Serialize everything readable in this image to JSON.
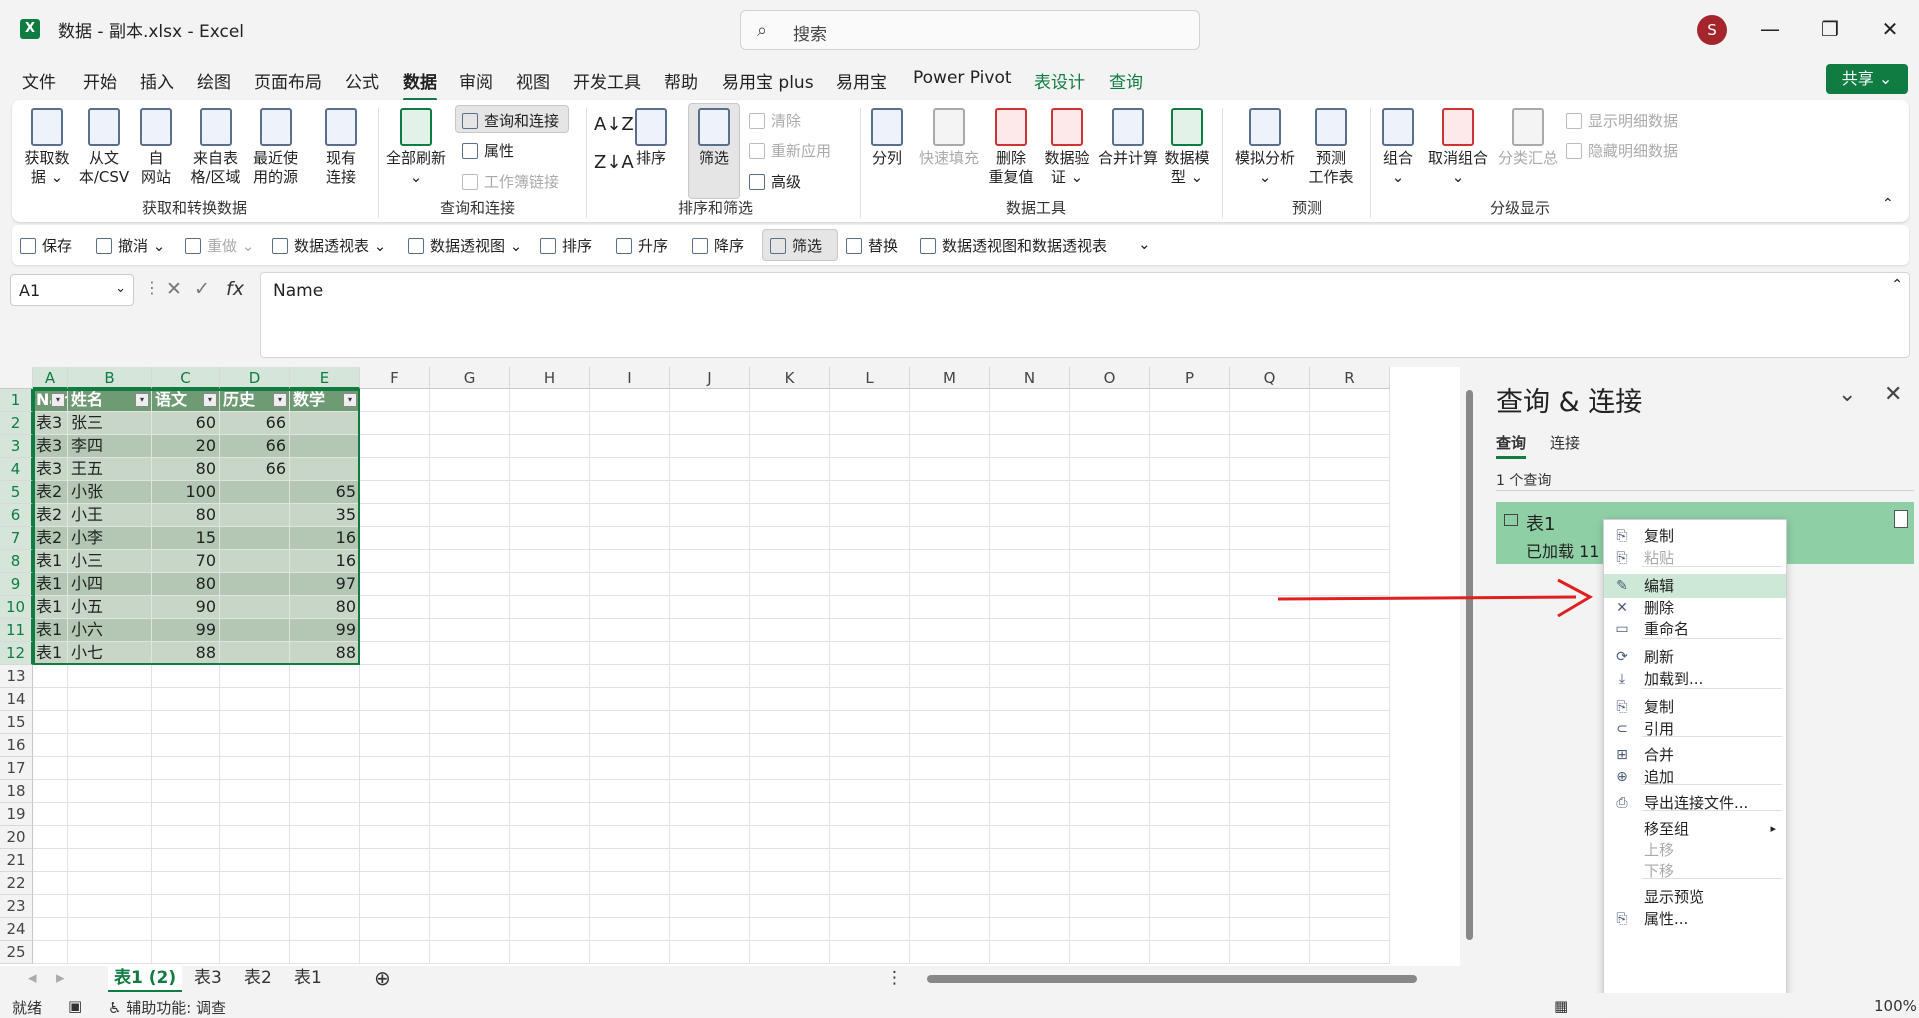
{
  "window": {
    "title": "数据 - 副本.xlsx  -  Excel",
    "search_placeholder": "搜索",
    "avatar": "S",
    "minimize": "—",
    "restore": "❐",
    "close": "✕"
  },
  "menu": {
    "items": [
      "文件",
      "开始",
      "插入",
      "绘图",
      "页面布局",
      "公式",
      "数据",
      "审阅",
      "视图",
      "开发工具",
      "帮助",
      "易用宝 plus",
      "易用宝",
      "Power Pivot",
      "表设计",
      "查询"
    ],
    "active": "数据",
    "share": "共享"
  },
  "ribbon": {
    "get_data": [
      "获取数",
      "据 ⌄"
    ],
    "from_csv": [
      "从文",
      "本/CSV"
    ],
    "from_web": [
      "自",
      "网站"
    ],
    "from_table": [
      "来自表",
      "格/区域"
    ],
    "recent": [
      "最近使",
      "用的源"
    ],
    "existing": [
      "现有",
      "连接"
    ],
    "group1": "获取和转换数据",
    "refresh_all": [
      "全部刷新",
      "⌄"
    ],
    "queries_conn": "查询和连接",
    "properties": "属性",
    "edit_links": "工作簿链接",
    "group2": "查询和连接",
    "sort": "排序",
    "filter": "筛选",
    "clear": "清除",
    "reapply": "重新应用",
    "advanced": "高级",
    "group3": "排序和筛选",
    "text_to_col": "分列",
    "flash_fill": "快速填充",
    "remove_dup": [
      "删除",
      "重复值"
    ],
    "validation": [
      "数据验",
      "证 ⌄"
    ],
    "consolidate": "合并计算",
    "data_model": [
      "数据模",
      "型 ⌄"
    ],
    "group4": "数据工具",
    "whatif": [
      "模拟分析",
      "⌄"
    ],
    "forecast": [
      "预测",
      "工作表"
    ],
    "group5": "预测",
    "group_btn": [
      "组合",
      "⌄"
    ],
    "ungroup": [
      "取消组合",
      "⌄"
    ],
    "subtotal": "分类汇总",
    "show_detail": "显示明细数据",
    "hide_detail": "隐藏明细数据",
    "group6": "分级显示"
  },
  "qat": {
    "save": "保存",
    "undo": "撤消",
    "redo": "重做",
    "pivot_table": "数据透视表",
    "pivot_chart": "数据透视图",
    "sort": "排序",
    "asc": "升序",
    "desc": "降序",
    "filter": "筛选",
    "replace": "替换",
    "pivot_both": "数据透视图和数据透视表"
  },
  "formula_bar": {
    "name_box": "A1",
    "content": "Name",
    "fx": "fx"
  },
  "columns": [
    "A",
    "B",
    "C",
    "D",
    "E",
    "F",
    "G",
    "H",
    "I",
    "J",
    "K",
    "L",
    "M",
    "N",
    "O",
    "P",
    "Q",
    "R"
  ],
  "rows": [
    "1",
    "2",
    "3",
    "4",
    "5",
    "6",
    "7",
    "8",
    "9",
    "10",
    "11",
    "12",
    "13",
    "14",
    "15",
    "16",
    "17",
    "18",
    "19",
    "20",
    "21",
    "22",
    "23",
    "24",
    "25"
  ],
  "table": {
    "headers": [
      "Name",
      "姓名",
      "语文",
      "历史",
      "数学"
    ],
    "data": [
      [
        "表3",
        "张三",
        "60",
        "66",
        ""
      ],
      [
        "表3",
        "李四",
        "20",
        "66",
        ""
      ],
      [
        "表3",
        "王五",
        "80",
        "66",
        ""
      ],
      [
        "表2",
        "小张",
        "100",
        "",
        "65"
      ],
      [
        "表2",
        "小王",
        "80",
        "",
        "35"
      ],
      [
        "表2",
        "小李",
        "15",
        "",
        "16"
      ],
      [
        "表1",
        "小三",
        "70",
        "",
        "16"
      ],
      [
        "表1",
        "小四",
        "80",
        "",
        "97"
      ],
      [
        "表1",
        "小五",
        "90",
        "",
        "80"
      ],
      [
        "表1",
        "小六",
        "99",
        "",
        "99"
      ],
      [
        "表1",
        "小七",
        "88",
        "",
        "88"
      ]
    ]
  },
  "sheet_tabs": [
    "表1 (2)",
    "表3",
    "表2",
    "表1"
  ],
  "status": {
    "ready": "就绪",
    "accessibility": "辅助功能: 调查",
    "zoom": "100%"
  },
  "pane": {
    "title": "查询 & 连接",
    "tab_queries": "查询",
    "tab_connections": "连接",
    "count": "1 个查询",
    "query_name": "表1",
    "query_status": "已加载 11"
  },
  "context_menu": {
    "items": [
      "复制",
      "粘贴",
      "编辑",
      "删除",
      "重命名",
      "刷新",
      "加载到...",
      "复制",
      "引用",
      "合并",
      "追加",
      "导出连接文件...",
      "移至组",
      "上移",
      "下移",
      "显示预览",
      "属性..."
    ]
  },
  "colors": {
    "accent": "#107c41",
    "table_header": "#6e9a74",
    "arrow": "#e02020"
  }
}
